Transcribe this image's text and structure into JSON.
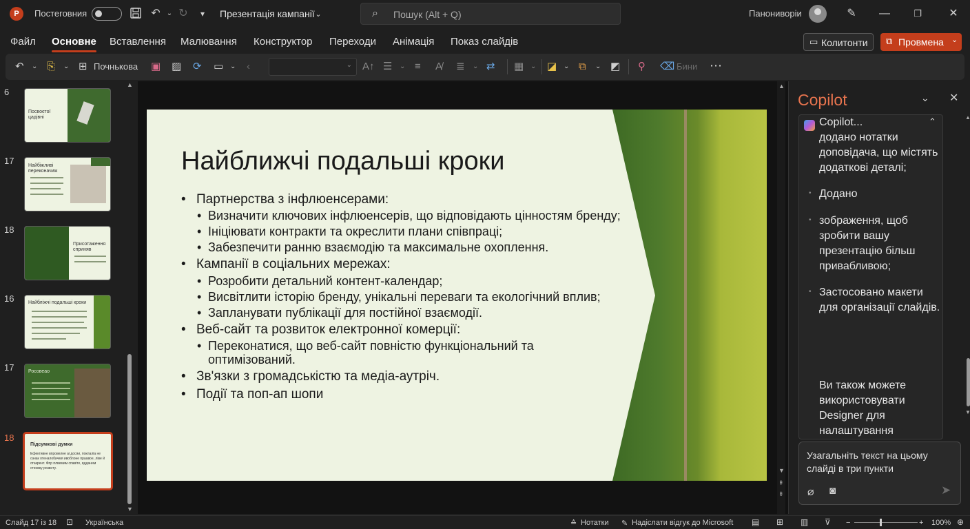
{
  "titlebar": {
    "autosave_label": "Постеговния",
    "doc_title": "Презентація кампанії",
    "search_placeholder": "Пошук (Alt + Q)",
    "username": "Панониворіи"
  },
  "tabs": [
    "Файл",
    "Основне",
    "Вставлення",
    "Малювання",
    "Конструктор",
    "Переходи",
    "Анімація",
    "Показ слайдів"
  ],
  "active_tab": "Основне",
  "buttons": {
    "comments": "Колитонти",
    "present": "Провмена"
  },
  "toolbar": {
    "new_slide_label": "Почнькова",
    "eraser_label": "Бини"
  },
  "thumbnails": [
    {
      "num": "6",
      "title": "Посвоєтої цадівні"
    },
    {
      "num": "17",
      "title": "Найбіжливі переконачиж"
    },
    {
      "num": "18",
      "title": "Присотаження сприняв"
    },
    {
      "num": "16",
      "title": "Найбліжчі подальші кроки"
    },
    {
      "num": "17",
      "title": "Росовеао"
    },
    {
      "num": "18",
      "title": "Підсумкові думки",
      "body": "Ефективне впровелне аі досяи, поклаліа не ознак отеналобичмя ивоблоне праавое, ліве й отакрент. Фпр плвемим спавітe, вдданим стенвку розвнту."
    }
  ],
  "slide": {
    "title": "Найближчі подальші кроки",
    "bullets": [
      {
        "level": 1,
        "text": "Партнерства з інфлюенсерами:"
      },
      {
        "level": 2,
        "text": "Визначити ключових інфлюенсерів, що відповідають цінностям бренду;"
      },
      {
        "level": 2,
        "text": "Ініціювати контракти та окреслити плани співпраці;"
      },
      {
        "level": 2,
        "text": "Забезпечити ранню взаємодію та максимальне охоплення."
      },
      {
        "level": 1,
        "text": "Кампанії в соціальних мережах:"
      },
      {
        "level": 2,
        "text": "Розробити детальний контент-календар;"
      },
      {
        "level": 2,
        "text": "Висвітлити історію бренду, унікальні переваги та екологічний вплив;"
      },
      {
        "level": 2,
        "text": "Запланувати публікації для постійної взаємодії."
      },
      {
        "level": 1,
        "text": "Веб-сайт та розвиток електронної комерції:"
      },
      {
        "level": 2,
        "text": "Переконатися, що веб-сайт повністю функціональний та"
      },
      {
        "level": 2,
        "text": "оптимізований.",
        "continuation": true
      },
      {
        "level": 1,
        "text": "Зв'язки з громадськістю та медіа-аутріч."
      },
      {
        "level": 1,
        "text": "Події та поп-ап шопи"
      }
    ]
  },
  "copilot": {
    "title": "Copilot",
    "card_header": "Copilot...",
    "items": [
      {
        "text": "додано нотатки доповідача, що містять додаткові деталі;",
        "dot": false
      },
      {
        "text": "Додано",
        "dot": true
      },
      {
        "text": "зображення, щоб зробити вашу презентацію більш привабливою;",
        "dot": true
      },
      {
        "text": "Застосовано макети для організації слайдів.",
        "dot": true
      },
      {
        "text": "Ви також можете використовувати Designer для налаштування",
        "dot": false
      }
    ],
    "input_text": "Узагальніть текст на цьому слайді в три пункти"
  },
  "statusbar": {
    "slide_info": "Слайд 17 із 18",
    "language": "Українська",
    "notes": "Нотатки",
    "feedback": "Надіслати відгук до Microsoft",
    "zoom": "100%"
  },
  "colors": {
    "accent": "#c43e1c",
    "copilot_title": "#e8744e",
    "slide_bg": "#eef3e2"
  }
}
